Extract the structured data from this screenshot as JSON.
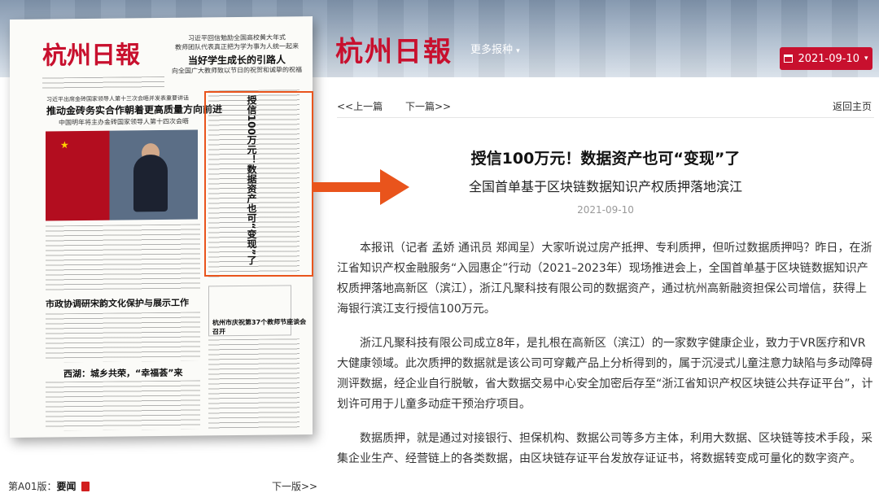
{
  "header": {
    "logo": "杭州日報",
    "more_label": "更多报种",
    "date": "2021-09-10"
  },
  "paper": {
    "masthead": "杭州日報",
    "top_sub1": "习近平回信勉励全国高校黄大年式",
    "top_sub2": "教师团队代表真正把为学为事为人统一起来",
    "top_headline": "当好学生成长的引路人",
    "top_sub3": "向全国广大教师致以节日的祝贺和诚挚的祝福",
    "lead_kicker": "习近平出席金砖国家领导人第十三次会晤并发表重要讲话",
    "lead_headline": "推动金砖务实合作朝着更高质量方向前进",
    "lead_deck": "中国明年将主办金砖国家领导人第十四次会晤",
    "vertical_headline": "授信100万元！数据资产也可“变现”了",
    "box_headline": "杭州市庆祝第37个教师节座谈会召开",
    "mid_headline": "市政协调研宋韵文化保护与展示工作",
    "bottom_headline": "西湖：城乡共荣，“幸福荟”来"
  },
  "footer": {
    "page_label": "第A01版：",
    "page_name": "要闻",
    "next_page": "下一版>>"
  },
  "article": {
    "prev": "<<上一篇",
    "next": "下一篇>>",
    "back": "返回主页",
    "title": "授信100万元！数据资产也可“变现”了",
    "subtitle": "全国首单基于区块链数据知识产权质押落地滨江",
    "date": "2021-09-10",
    "paragraphs": [
      "本报讯（记者 孟娇 通讯员 郑闻呈）大家听说过房产抵押、专利质押，但听过数据质押吗？昨日，在浙江省知识产权金融服务“入园惠企”行动（2021–2023年）现场推进会上，全国首单基于区块链数据知识产权质押落地高新区（滨江），浙江凡聚科技有限公司的数据资产，通过杭州高新融资担保公司增信，获得上海银行滨江支行授信100万元。",
      "浙江凡聚科技有限公司成立8年，是扎根在高新区（滨江）的一家数字健康企业，致力于VR医疗和VR大健康领域。此次质押的数据就是该公司可穿戴产品上分析得到的，属于沉浸式儿童注意力缺陷与多动障碍测评数据，经企业自行脱敏，省大数据交易中心安全加密后存至“浙江省知识产权区块链公共存证平台”，计划许可用于儿童多动症干预治疗项目。",
      "数据质押，就是通过对接银行、担保机构、数据公司等多方主体，利用大数据、区块链等技术手段，采集企业生产、经营链上的各类数据，由区块链存证平台发放存证证书，将数据转变成可量化的数字资产。"
    ]
  }
}
